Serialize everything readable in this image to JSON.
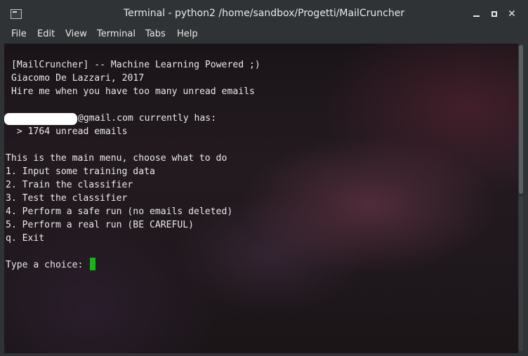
{
  "window": {
    "title": "Terminal - python2  /home/sandbox/Progetti/MailCruncher"
  },
  "menubar": {
    "items": [
      "File",
      "Edit",
      "View",
      "Terminal",
      "Tabs",
      "Help"
    ]
  },
  "terminal": {
    "banner": [
      "[MailCruncher] -- Machine Learning Powered ;)",
      "Giacomo De Lazzari, 2017",
      "Hire me when you have too many unread emails"
    ],
    "email_suffix": "@gmail.com currently has:",
    "unread_line": " > 1764 unread emails",
    "menu_title": "This is the main menu, choose what to do",
    "menu_options": [
      "1. Input some training data",
      "2. Train the classifier",
      "3. Test the classifier",
      "4. Perform a safe run (no emails deleted)",
      "5. Perform a real run (BE CAREFUL)",
      "q. Exit"
    ],
    "prompt": "Type a choice: "
  },
  "colors": {
    "cursor": "#18b418",
    "window_chrome": "#2f3335",
    "terminal_text": "#e9e9e9"
  },
  "icons": {
    "app": "terminal-icon",
    "minimize": "minimize-icon",
    "maximize": "maximize-icon",
    "close": "close-icon"
  }
}
